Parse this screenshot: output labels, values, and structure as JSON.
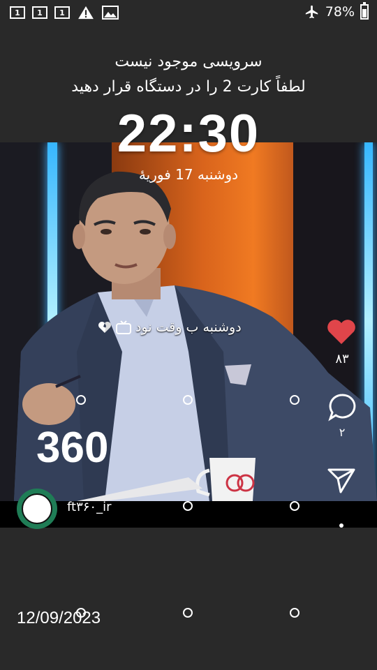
{
  "status_bar": {
    "sim_icons": [
      "1",
      "1",
      "1"
    ],
    "battery_percent": "78%",
    "battery_level": 0.78,
    "icons": [
      "sim-1-icon",
      "sim-1-icon",
      "sim-1-icon",
      "warning-icon",
      "image-icon",
      "airplane-mode-icon",
      "battery-icon"
    ]
  },
  "lockscreen": {
    "carrier_line1": "سرویسی موجود نیست",
    "carrier_line2": "لطفاً کارت 2 را در دستگاه قرار دهید",
    "time": "22:30",
    "date": "دوشنبه 17 فوریهٔ",
    "footer_date": "12/09/2023"
  },
  "post": {
    "caption": "دوشنبه ب وقت نود",
    "likes": "۸۳",
    "comments": "۲",
    "username": "ft۳۶۰_ir",
    "logo_text": "360",
    "colors": {
      "like": "#e0454a",
      "avatar": "#1f7d56",
      "neon": "#36b6ff",
      "backdrop": "#f07a22"
    }
  }
}
